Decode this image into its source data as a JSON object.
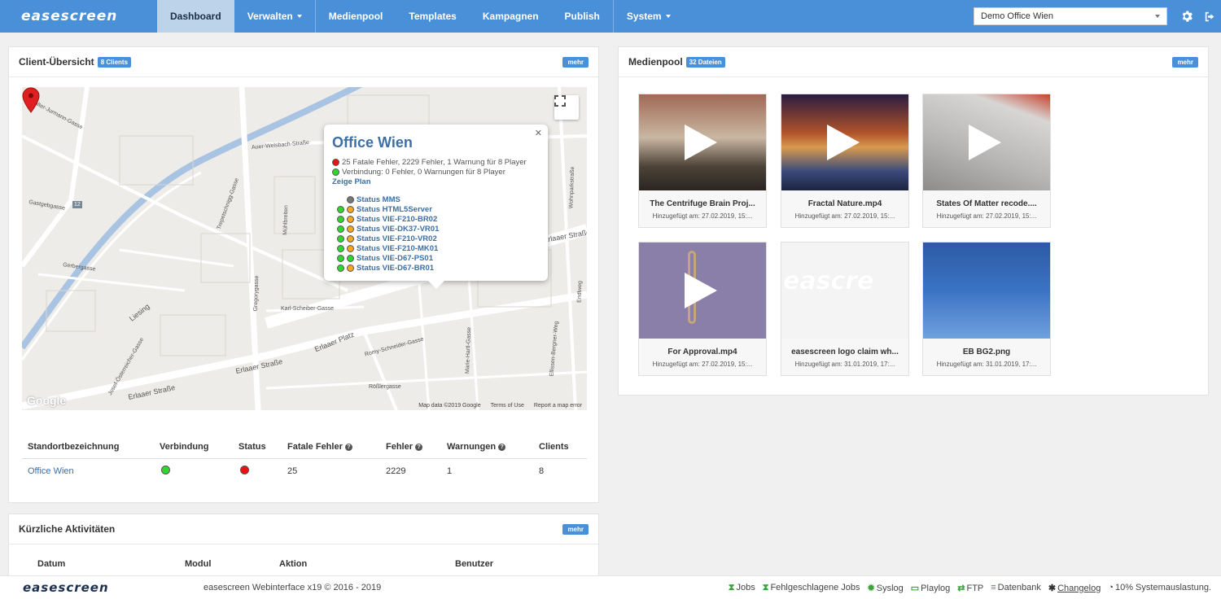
{
  "brand": {
    "logo_text": "easescreen"
  },
  "nav": {
    "items": [
      {
        "label": "Dashboard"
      },
      {
        "label": "Verwalten"
      },
      {
        "label": "Medienpool"
      },
      {
        "label": "Templates"
      },
      {
        "label": "Kampagnen"
      },
      {
        "label": "Publish"
      },
      {
        "label": "System"
      }
    ],
    "location_select": "Demo Office Wien"
  },
  "clients": {
    "title": "Client-Übersicht",
    "badge": "8 Clients",
    "more": "mehr",
    "map": {
      "street_labels": [
        "Walter-Jurmann-Gasse",
        "Auer-Welsbach-Straße",
        "Gastgebgasse",
        "Gerbergasse",
        "Liesing",
        "Karl-Scheiber-Gasse",
        "Erlaaer Platz",
        "Erlaaer Straße",
        "Romy-Schneider-Gasse",
        "Rößlergasse",
        "Ellissen-Bergner-Weg",
        "Erlaaer Straße",
        "Josef-Österreicher-Gasse",
        "Marie-Hartl-Gasse",
        "Erlaaer Straße",
        "Wohnparkstraße",
        "Endlweg",
        "Trepetschnigg-Gasse",
        "Gregorygasse",
        "Mühlbreiten",
        "12"
      ],
      "attribution": "Map data ©2019 Google",
      "terms": "Terms of Use",
      "report": "Report a map error",
      "google": "Google"
    },
    "popup": {
      "title": "Office Wien",
      "line1": "25 Fatale Fehler, 2229 Fehler, 1 Warnung für 8 Player",
      "line2": "Verbindung: 0 Fehler, 0 Warnungen für 8 Player",
      "plan_link": "Zeige Plan",
      "statuses": [
        {
          "label": "Status MMS",
          "dots": [
            "gray"
          ]
        },
        {
          "label": "Status HTML5Server",
          "dots": [
            "green",
            "orange"
          ]
        },
        {
          "label": "Status VIE-F210-BR02",
          "dots": [
            "green",
            "orange"
          ]
        },
        {
          "label": "Status VIE-DK37-VR01",
          "dots": [
            "green",
            "orange"
          ]
        },
        {
          "label": "Status VIE-F210-VR02",
          "dots": [
            "green",
            "orange"
          ]
        },
        {
          "label": "Status VIE-F210-MK01",
          "dots": [
            "green",
            "orange"
          ]
        },
        {
          "label": "Status VIE-D67-PS01",
          "dots": [
            "green",
            "green"
          ]
        },
        {
          "label": "Status VIE-D67-BR01",
          "dots": [
            "green",
            "orange"
          ]
        }
      ]
    },
    "table": {
      "headers": [
        "Standortbezeichnung",
        "Verbindung",
        "Status",
        "Fatale Fehler",
        "Fehler",
        "Warnungen",
        "Clients"
      ],
      "rows": [
        {
          "name": "Office Wien",
          "verbindung": "green",
          "status": "red",
          "fatal": "25",
          "fehler": "2229",
          "warnungen": "1",
          "clients": "8"
        }
      ]
    }
  },
  "media": {
    "title": "Medienpool",
    "badge": "32 Dateien",
    "more": "mehr",
    "items": [
      {
        "name": "The Centrifuge Brain Proj...",
        "date": "Hinzugefügt am: 27.02.2019, 15:...",
        "video": true
      },
      {
        "name": "Fractal Nature.mp4",
        "date": "Hinzugefügt am: 27.02.2019, 15:...",
        "video": true
      },
      {
        "name": "States Of Matter recode....",
        "date": "Hinzugefügt am: 27.02.2019, 15:...",
        "video": true
      },
      {
        "name": "For Approval.mp4",
        "date": "Hinzugefügt am: 27.02.2019, 15:...",
        "video": true
      },
      {
        "name": "easescreen logo claim wh...",
        "date": "Hinzugefügt am: 31.01.2019, 17:...",
        "video": false
      },
      {
        "name": "EB BG2.png",
        "date": "Hinzugefügt am: 31.01.2019, 17:...",
        "video": false
      }
    ]
  },
  "activities": {
    "title": "Kürzliche Aktivitäten",
    "more": "mehr",
    "headers": [
      "Datum",
      "Modul",
      "Aktion",
      "Benutzer"
    ]
  },
  "footer": {
    "logo_text": "easescreen",
    "copyright": "easescreen Webinterface x19 © 2016 - 2019",
    "links": [
      "Jobs",
      "Fehlgeschlagene Jobs",
      "Syslog",
      "Playlog",
      "FTP",
      "Datenbank",
      "Changelog"
    ],
    "load": "10% Systemauslastung."
  }
}
